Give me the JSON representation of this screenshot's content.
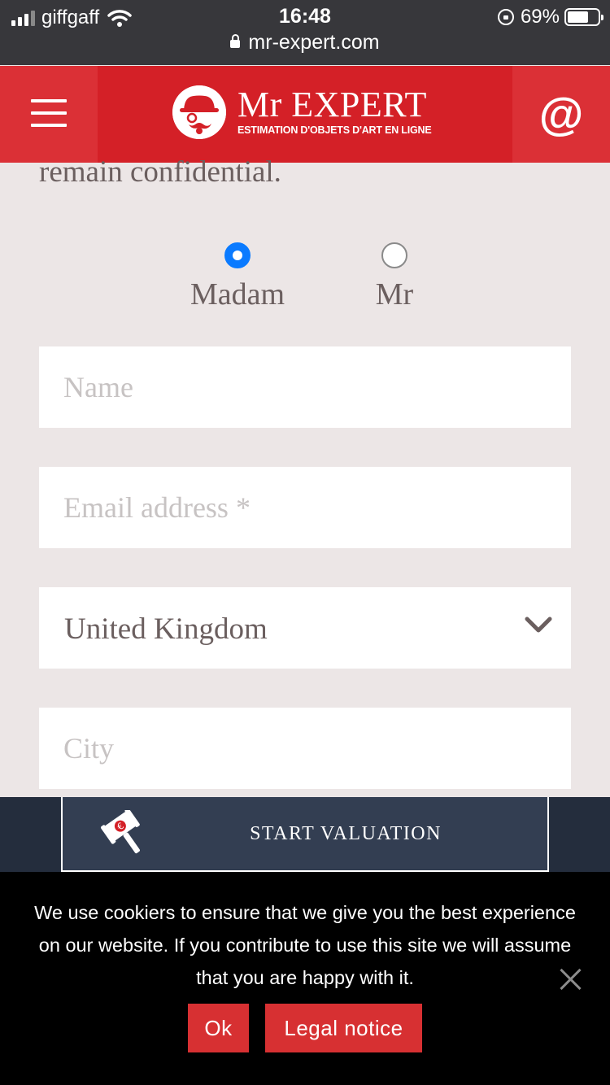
{
  "status_bar": {
    "carrier": "giffgaff",
    "time": "16:48",
    "battery": "69%",
    "battery_level": 0.69,
    "url": "mr-expert.com"
  },
  "header": {
    "logo_title": "Mr EXPERT",
    "logo_subtitle": "ESTIMATION D'OBJETS D'ART EN LIGNE",
    "contact_icon": "@"
  },
  "form": {
    "intro_text": "remain confidential.",
    "title_options": [
      {
        "label": "Madam",
        "selected": true
      },
      {
        "label": "Mr",
        "selected": false
      }
    ],
    "name_placeholder": "Name",
    "email_placeholder": "Email address *",
    "country_value": "United Kingdom",
    "city_placeholder": "City"
  },
  "valuation": {
    "button_label": "START VALUATION"
  },
  "cookie_banner": {
    "text": "We use cookiers to ensure that we give you the best experience on our website. If you contribute to use this site we will assume that you are happy with it.",
    "ok_label": "Ok",
    "legal_label": "Legal notice"
  },
  "colors": {
    "brand_red": "#d42027",
    "navy": "#333e52",
    "radio_blue": "#0a7aff"
  }
}
